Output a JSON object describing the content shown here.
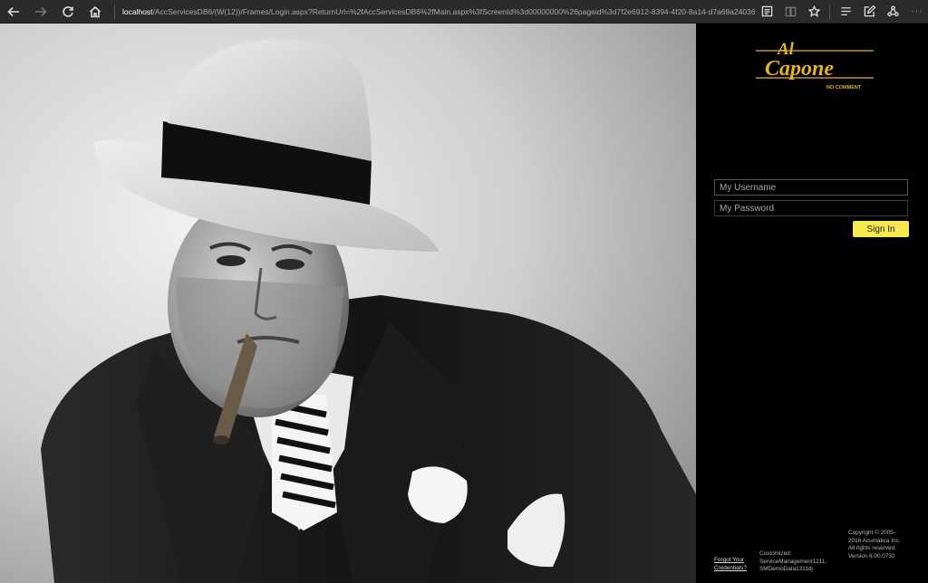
{
  "browser": {
    "back_icon": "arrow-left-icon",
    "forward_icon": "arrow-right-icon",
    "refresh_icon": "refresh-icon",
    "home_icon": "home-icon",
    "url_host": "localhost",
    "url_path": "/AccServicesDB6/(W(12))/Frames/Login.aspx?ReturnUrl=%2fAccServicesDB6%2fMain.aspx%3fScreenId%3d00000000%26pageid%3d7f2e6912-8394-4f20-8a14-d7a69a24036c",
    "tools": [
      "reading-view-icon",
      "book-icon",
      "favorite-star-icon",
      "hub-icon",
      "web-note-icon",
      "share-icon",
      "more-icon"
    ]
  },
  "login": {
    "logo_word_1": "Al",
    "logo_word_2": "Capone",
    "logo_tagline": "NO COMMENT",
    "username_placeholder": "My Username",
    "password_placeholder": "My Password",
    "signin_label": "Sign In",
    "forgot_line1": "Forgot Your",
    "forgot_line2": "Credentials?",
    "custom_line1": "Customized:",
    "custom_line2": "ServiceManagement1211,",
    "custom_line3": "SMDemoData1311dj",
    "copy_line1": "Copyright © 2005-",
    "copy_line2": "2016 Acumatica Inc.",
    "copy_line3": "All rights reserved.",
    "copy_line4": "Version 6.00.0732",
    "accent_color": "#f7e84e",
    "logo_color": "#e2b227"
  }
}
